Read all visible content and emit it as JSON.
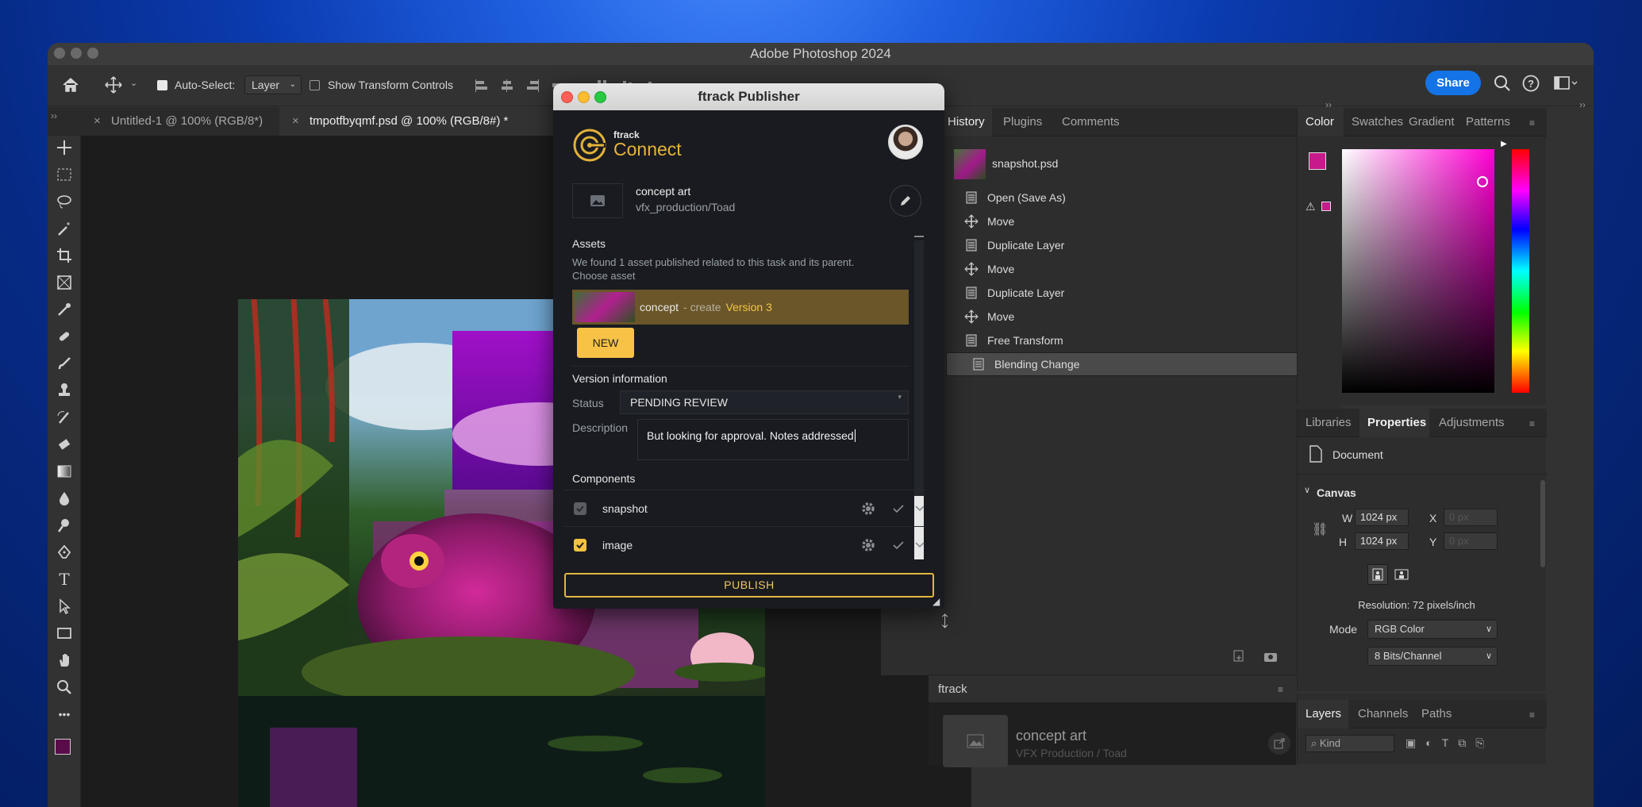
{
  "window": {
    "title": "Adobe Photoshop 2024"
  },
  "options_bar": {
    "auto_select_label": "Auto-Select:",
    "auto_select_value": "Layer",
    "show_transform_label": "Show Transform Controls",
    "more_label": "...",
    "share_label": "Share"
  },
  "doc_tabs": [
    {
      "label": "Untitled-1 @ 100% (RGB/8*)",
      "close": "×"
    },
    {
      "label": "tmpotfbyqmf.psd @ 100% (RGB/8#) *",
      "close": "×"
    }
  ],
  "history_panel": {
    "tabs": [
      "History",
      "Plugins",
      "Comments"
    ],
    "snapshot": "snapshot.psd",
    "items": [
      {
        "label": "Open (Save As)",
        "icon": "document-icon"
      },
      {
        "label": "Move",
        "icon": "move-icon"
      },
      {
        "label": "Duplicate Layer",
        "icon": "document-icon"
      },
      {
        "label": "Move",
        "icon": "move-icon"
      },
      {
        "label": "Duplicate Layer",
        "icon": "document-icon"
      },
      {
        "label": "Move",
        "icon": "move-icon"
      },
      {
        "label": "Free Transform",
        "icon": "document-icon"
      },
      {
        "label": "Blending Change",
        "icon": "document-icon"
      }
    ],
    "selected_index": 7
  },
  "color_panel": {
    "tabs": [
      "Color",
      "Swatches",
      "Gradient",
      "Patterns"
    ],
    "foreground": "#c81a8c",
    "hue": "#ff00d4"
  },
  "properties_panel": {
    "tabs": [
      "Libraries",
      "Properties",
      "Adjustments"
    ],
    "document_label": "Document",
    "section": "Canvas",
    "w_label": "W",
    "w_value": "1024 px",
    "h_label": "H",
    "h_value": "1024 px",
    "x_label": "X",
    "x_placeholder": "0 px",
    "y_label": "Y",
    "y_placeholder": "0 px",
    "resolution": "Resolution: 72 pixels/inch",
    "mode_label": "Mode",
    "mode_value": "RGB Color",
    "bits_value": "8 Bits/Channel"
  },
  "layers_panel": {
    "tabs": [
      "Layers",
      "Channels",
      "Paths"
    ],
    "filter_placeholder": "Kind"
  },
  "ftrack_panel": {
    "tab": "ftrack",
    "title": "concept art",
    "subtitle": "VFX Production / Toad"
  },
  "publisher": {
    "title": "ftrack Publisher",
    "brand_small": "ftrack",
    "brand_large": "Connect",
    "task_name": "concept art",
    "task_path": "vfx_production/Toad",
    "assets_heading": "Assets",
    "assets_note_1": "We found 1 asset published related to this task and its parent.",
    "assets_note_2": "Choose asset",
    "asset_name": "concept",
    "asset_action": "- create",
    "asset_version": "Version 3",
    "new_label": "NEW",
    "version_heading": "Version information",
    "status_label": "Status",
    "status_value": "PENDING REVIEW",
    "description_label": "Description",
    "description_value": "But looking for approval. Notes addressed",
    "components_heading": "Components",
    "components": [
      {
        "name": "snapshot",
        "checked": true,
        "enabled": false
      },
      {
        "name": "image",
        "checked": true,
        "enabled": true
      }
    ],
    "publish_label": "PUBLISH",
    "accent": "#f0c23e"
  }
}
